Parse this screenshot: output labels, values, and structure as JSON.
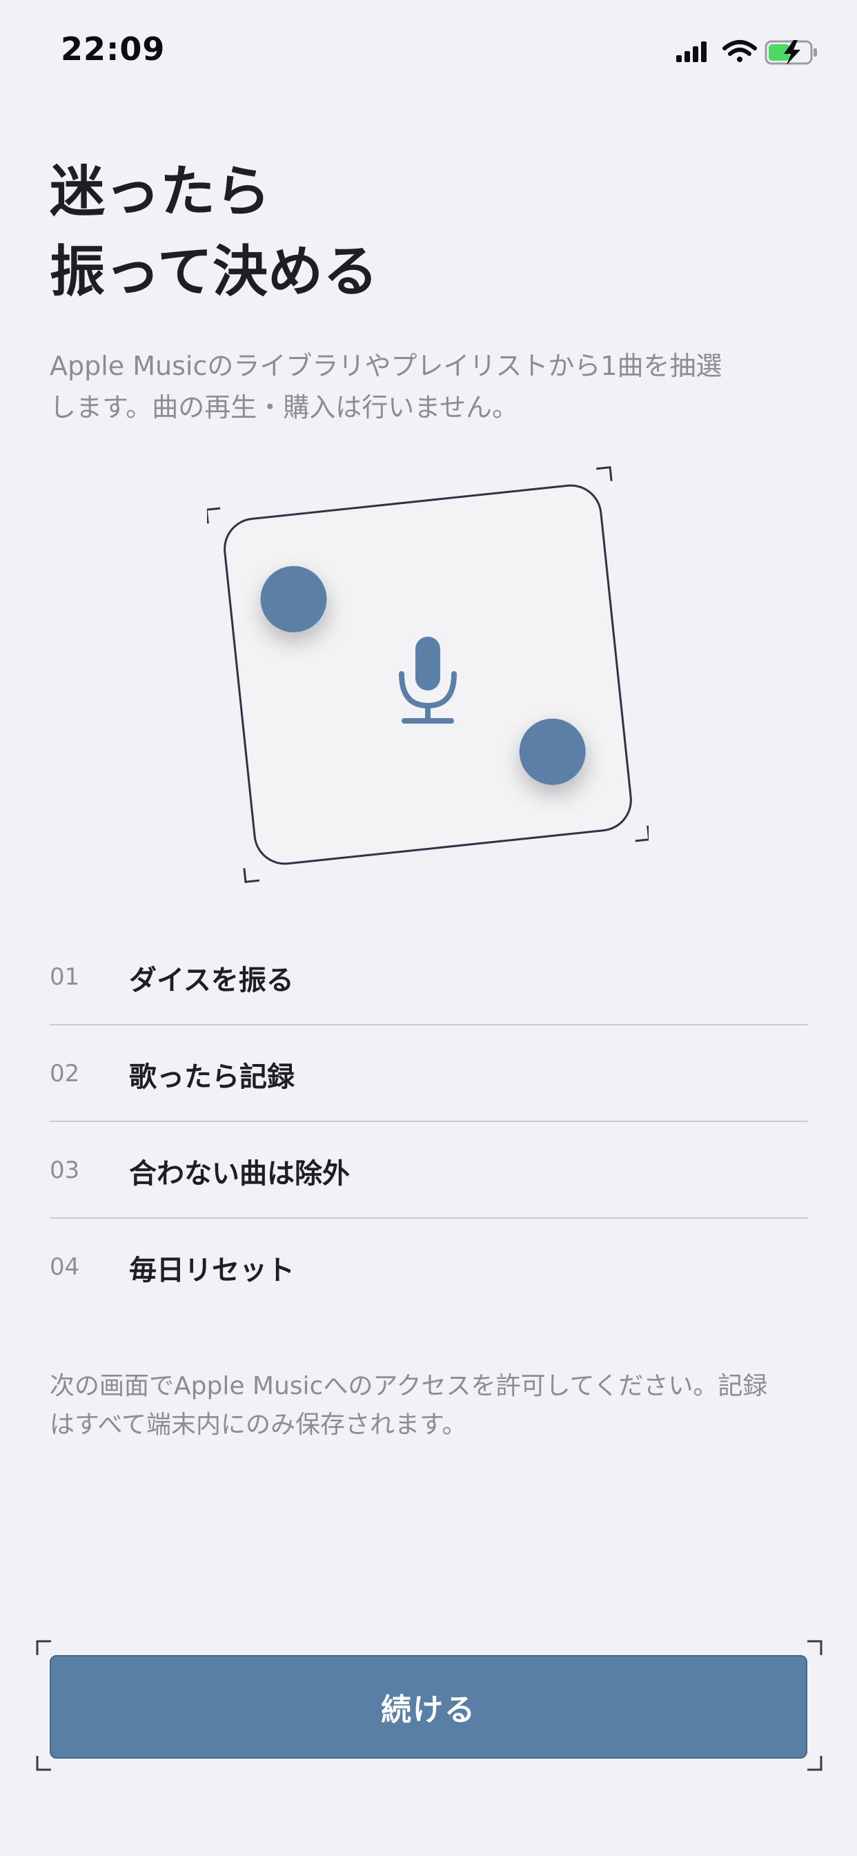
{
  "status_bar": {
    "time": "22:09"
  },
  "header": {
    "title_line1": "迷ったら",
    "title_line2": "振って決める",
    "subtitle_line1": "Apple Musicのライブラリやプレイリストから1曲を抽選",
    "subtitle_line2": "します。曲の再生・購入は行いません。"
  },
  "illustration": {
    "icons": [
      "dice-icon",
      "microphone-icon"
    ],
    "accent_color": "#5B7FA6",
    "outline_color": "#2B3545"
  },
  "steps": [
    {
      "num": "01",
      "label": "ダイスを振る"
    },
    {
      "num": "02",
      "label": "歌ったら記録"
    },
    {
      "num": "03",
      "label": "合わない曲は除外"
    },
    {
      "num": "04",
      "label": "毎日リセット"
    }
  ],
  "note": {
    "line1": "次の画面でApple Musicへのアクセスを許可してください。記録",
    "line2": "はすべて端末内にのみ保存されます。"
  },
  "continue_button": {
    "label": "続ける",
    "color": "#597FA5"
  }
}
